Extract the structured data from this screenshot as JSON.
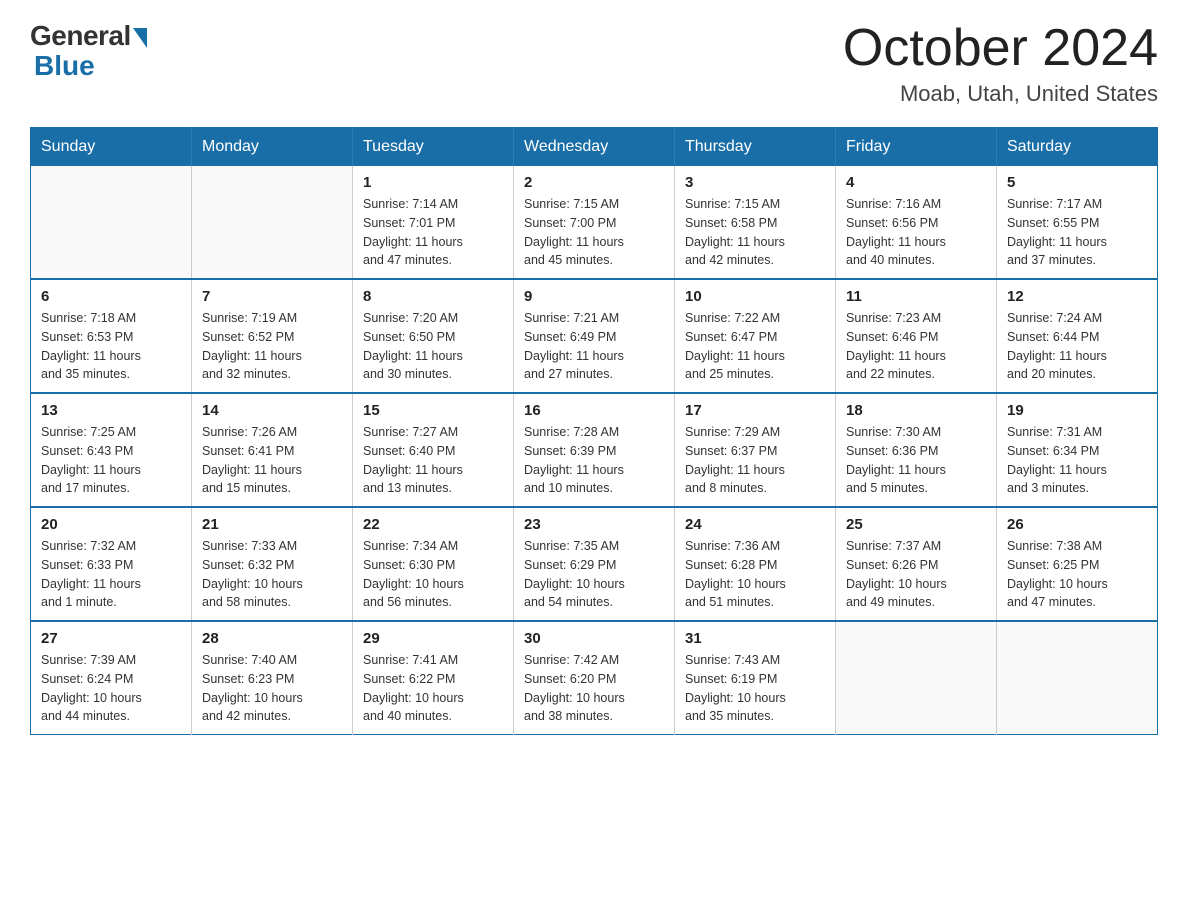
{
  "logo": {
    "general": "General",
    "blue": "Blue"
  },
  "title": "October 2024",
  "location": "Moab, Utah, United States",
  "days_header": [
    "Sunday",
    "Monday",
    "Tuesday",
    "Wednesday",
    "Thursday",
    "Friday",
    "Saturday"
  ],
  "weeks": [
    [
      {
        "day": "",
        "info": ""
      },
      {
        "day": "",
        "info": ""
      },
      {
        "day": "1",
        "info": "Sunrise: 7:14 AM\nSunset: 7:01 PM\nDaylight: 11 hours\nand 47 minutes."
      },
      {
        "day": "2",
        "info": "Sunrise: 7:15 AM\nSunset: 7:00 PM\nDaylight: 11 hours\nand 45 minutes."
      },
      {
        "day": "3",
        "info": "Sunrise: 7:15 AM\nSunset: 6:58 PM\nDaylight: 11 hours\nand 42 minutes."
      },
      {
        "day": "4",
        "info": "Sunrise: 7:16 AM\nSunset: 6:56 PM\nDaylight: 11 hours\nand 40 minutes."
      },
      {
        "day": "5",
        "info": "Sunrise: 7:17 AM\nSunset: 6:55 PM\nDaylight: 11 hours\nand 37 minutes."
      }
    ],
    [
      {
        "day": "6",
        "info": "Sunrise: 7:18 AM\nSunset: 6:53 PM\nDaylight: 11 hours\nand 35 minutes."
      },
      {
        "day": "7",
        "info": "Sunrise: 7:19 AM\nSunset: 6:52 PM\nDaylight: 11 hours\nand 32 minutes."
      },
      {
        "day": "8",
        "info": "Sunrise: 7:20 AM\nSunset: 6:50 PM\nDaylight: 11 hours\nand 30 minutes."
      },
      {
        "day": "9",
        "info": "Sunrise: 7:21 AM\nSunset: 6:49 PM\nDaylight: 11 hours\nand 27 minutes."
      },
      {
        "day": "10",
        "info": "Sunrise: 7:22 AM\nSunset: 6:47 PM\nDaylight: 11 hours\nand 25 minutes."
      },
      {
        "day": "11",
        "info": "Sunrise: 7:23 AM\nSunset: 6:46 PM\nDaylight: 11 hours\nand 22 minutes."
      },
      {
        "day": "12",
        "info": "Sunrise: 7:24 AM\nSunset: 6:44 PM\nDaylight: 11 hours\nand 20 minutes."
      }
    ],
    [
      {
        "day": "13",
        "info": "Sunrise: 7:25 AM\nSunset: 6:43 PM\nDaylight: 11 hours\nand 17 minutes."
      },
      {
        "day": "14",
        "info": "Sunrise: 7:26 AM\nSunset: 6:41 PM\nDaylight: 11 hours\nand 15 minutes."
      },
      {
        "day": "15",
        "info": "Sunrise: 7:27 AM\nSunset: 6:40 PM\nDaylight: 11 hours\nand 13 minutes."
      },
      {
        "day": "16",
        "info": "Sunrise: 7:28 AM\nSunset: 6:39 PM\nDaylight: 11 hours\nand 10 minutes."
      },
      {
        "day": "17",
        "info": "Sunrise: 7:29 AM\nSunset: 6:37 PM\nDaylight: 11 hours\nand 8 minutes."
      },
      {
        "day": "18",
        "info": "Sunrise: 7:30 AM\nSunset: 6:36 PM\nDaylight: 11 hours\nand 5 minutes."
      },
      {
        "day": "19",
        "info": "Sunrise: 7:31 AM\nSunset: 6:34 PM\nDaylight: 11 hours\nand 3 minutes."
      }
    ],
    [
      {
        "day": "20",
        "info": "Sunrise: 7:32 AM\nSunset: 6:33 PM\nDaylight: 11 hours\nand 1 minute."
      },
      {
        "day": "21",
        "info": "Sunrise: 7:33 AM\nSunset: 6:32 PM\nDaylight: 10 hours\nand 58 minutes."
      },
      {
        "day": "22",
        "info": "Sunrise: 7:34 AM\nSunset: 6:30 PM\nDaylight: 10 hours\nand 56 minutes."
      },
      {
        "day": "23",
        "info": "Sunrise: 7:35 AM\nSunset: 6:29 PM\nDaylight: 10 hours\nand 54 minutes."
      },
      {
        "day": "24",
        "info": "Sunrise: 7:36 AM\nSunset: 6:28 PM\nDaylight: 10 hours\nand 51 minutes."
      },
      {
        "day": "25",
        "info": "Sunrise: 7:37 AM\nSunset: 6:26 PM\nDaylight: 10 hours\nand 49 minutes."
      },
      {
        "day": "26",
        "info": "Sunrise: 7:38 AM\nSunset: 6:25 PM\nDaylight: 10 hours\nand 47 minutes."
      }
    ],
    [
      {
        "day": "27",
        "info": "Sunrise: 7:39 AM\nSunset: 6:24 PM\nDaylight: 10 hours\nand 44 minutes."
      },
      {
        "day": "28",
        "info": "Sunrise: 7:40 AM\nSunset: 6:23 PM\nDaylight: 10 hours\nand 42 minutes."
      },
      {
        "day": "29",
        "info": "Sunrise: 7:41 AM\nSunset: 6:22 PM\nDaylight: 10 hours\nand 40 minutes."
      },
      {
        "day": "30",
        "info": "Sunrise: 7:42 AM\nSunset: 6:20 PM\nDaylight: 10 hours\nand 38 minutes."
      },
      {
        "day": "31",
        "info": "Sunrise: 7:43 AM\nSunset: 6:19 PM\nDaylight: 10 hours\nand 35 minutes."
      },
      {
        "day": "",
        "info": ""
      },
      {
        "day": "",
        "info": ""
      }
    ]
  ]
}
